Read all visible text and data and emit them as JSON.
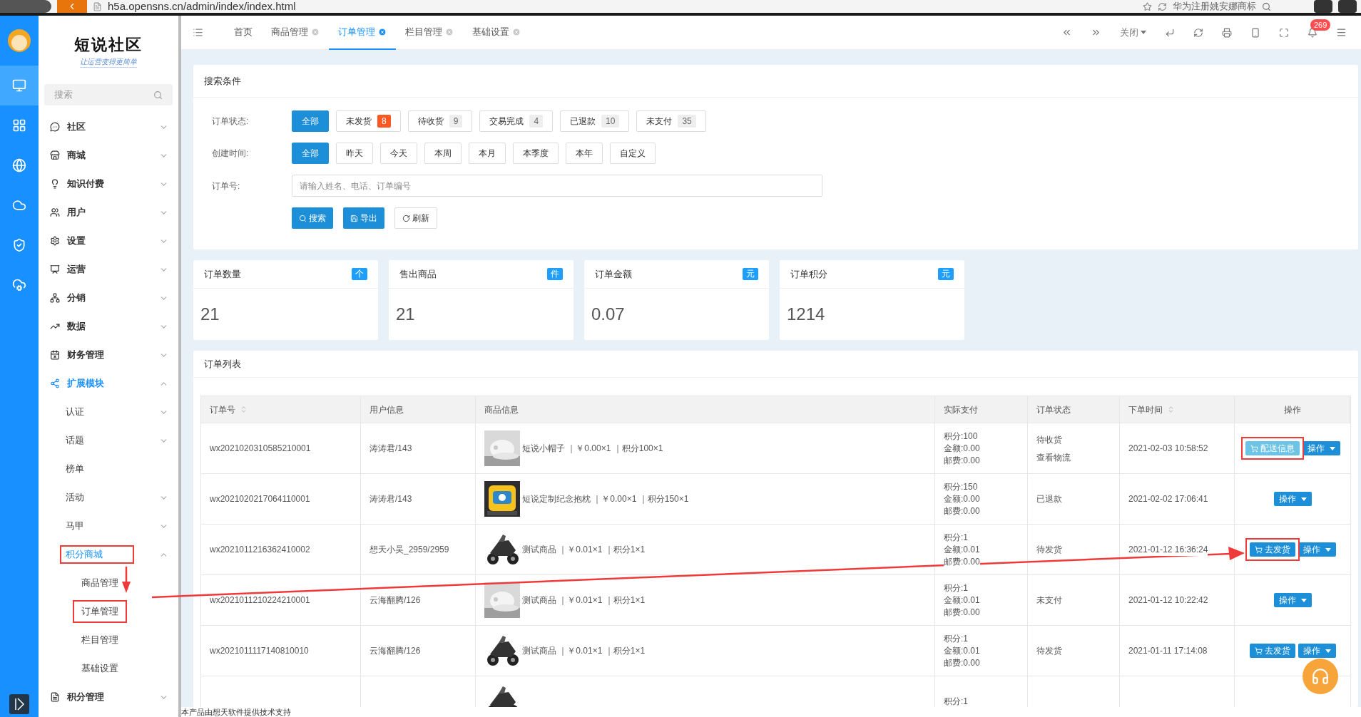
{
  "browser": {
    "url": "h5a.opensns.cn/admin/index/index.html",
    "search_text": "华为注册姚安娜商标"
  },
  "rail_items": [
    {
      "selected": true
    },
    {
      "selected": false
    },
    {
      "selected": false
    },
    {
      "selected": false
    },
    {
      "selected": false
    },
    {
      "selected": false
    }
  ],
  "sidebar": {
    "logo": "短说社区",
    "slogan": "让运营变得更简单",
    "search": {
      "placeholder": "搜索"
    },
    "items": [
      {
        "label": "社区",
        "expanded": false,
        "selected": false
      },
      {
        "label": "商城",
        "expanded": false,
        "selected": false
      },
      {
        "label": "知识付费",
        "expanded": false,
        "selected": false
      },
      {
        "label": "用户",
        "expanded": false,
        "selected": false
      },
      {
        "label": "设置",
        "expanded": false,
        "selected": false
      },
      {
        "label": "运营",
        "expanded": false,
        "selected": false
      },
      {
        "label": "分销",
        "expanded": false,
        "selected": false
      },
      {
        "label": "数据",
        "expanded": false,
        "selected": false
      },
      {
        "label": "财务管理",
        "expanded": false,
        "selected": false
      },
      {
        "label": "扩展模块",
        "expanded": true,
        "selected": true,
        "children": [
          {
            "label": "认证",
            "has_children": true,
            "expanded": false,
            "selected": false,
            "highlighted": false
          },
          {
            "label": "话题",
            "has_children": true,
            "expanded": false,
            "selected": false,
            "highlighted": false
          },
          {
            "label": "榜单",
            "has_children": false,
            "selected": false,
            "highlighted": false
          },
          {
            "label": "活动",
            "has_children": true,
            "expanded": false,
            "selected": false,
            "highlighted": false
          },
          {
            "label": "马甲",
            "has_children": true,
            "expanded": false,
            "selected": false,
            "highlighted": false
          },
          {
            "label": "积分商城",
            "has_children": true,
            "expanded": true,
            "selected": true,
            "highlighted": true,
            "children": [
              {
                "label": "商品管理",
                "highlighted": false
              },
              {
                "label": "订单管理",
                "highlighted": true
              },
              {
                "label": "栏目管理",
                "highlighted": false
              },
              {
                "label": "基础设置",
                "highlighted": false
              }
            ]
          }
        ]
      },
      {
        "label": "积分管理",
        "expanded": false,
        "selected": false
      }
    ]
  },
  "tabs": [
    {
      "label": "首页",
      "closable": false,
      "selected": false
    },
    {
      "label": "商品管理",
      "closable": true,
      "selected": false
    },
    {
      "label": "订单管理",
      "closable": true,
      "selected": true
    },
    {
      "label": "栏目管理",
      "closable": true,
      "selected": false
    },
    {
      "label": "基础设置",
      "closable": true,
      "selected": false
    }
  ],
  "toolbar": {
    "close_menu": "关闭",
    "notification_count": "269"
  },
  "search_panel": {
    "title": "搜索条件",
    "status_filter": {
      "label": "订单状态:",
      "options": [
        {
          "label": "全部",
          "selected": true
        },
        {
          "label": "未发货",
          "count": "8",
          "alert": true,
          "selected": false
        },
        {
          "label": "待收货",
          "count": "9",
          "alert": false,
          "selected": false
        },
        {
          "label": "交易完成",
          "count": "4",
          "alert": false,
          "selected": false
        },
        {
          "label": "已退款",
          "count": "10",
          "alert": false,
          "selected": false
        },
        {
          "label": "未支付",
          "count": "35",
          "alert": false,
          "selected": false
        }
      ]
    },
    "time_filter": {
      "label": "创建时间:",
      "options": [
        {
          "label": "全部",
          "selected": true
        },
        {
          "label": "昨天",
          "selected": false
        },
        {
          "label": "今天",
          "selected": false
        },
        {
          "label": "本周",
          "selected": false
        },
        {
          "label": "本月",
          "selected": false
        },
        {
          "label": "本季度",
          "selected": false
        },
        {
          "label": "本年",
          "selected": false
        },
        {
          "label": "自定义",
          "selected": false
        }
      ]
    },
    "order_field": {
      "label": "订单号:",
      "placeholder": "请输入姓名、电话、订单编号"
    },
    "buttons": [
      {
        "label": "搜索",
        "kind": "search"
      },
      {
        "label": "导出",
        "kind": "export"
      },
      {
        "label": "刷新",
        "kind": "refresh"
      }
    ]
  },
  "stats": [
    {
      "title": "订单数量",
      "unit": "个",
      "value": "21"
    },
    {
      "title": "售出商品",
      "unit": "件",
      "value": "21"
    },
    {
      "title": "订单金额",
      "unit": "元",
      "value": "0.07"
    },
    {
      "title": "订单积分",
      "unit": "元",
      "value": "1214"
    }
  ],
  "order_list": {
    "title": "订单列表",
    "columns": [
      {
        "label": "订单号",
        "sortable": true
      },
      {
        "label": "用户信息",
        "sortable": false
      },
      {
        "label": "商品信息",
        "sortable": false
      },
      {
        "label": "实际支付",
        "sortable": false
      },
      {
        "label": "订单状态",
        "sortable": false
      },
      {
        "label": "下单时间",
        "sortable": true
      },
      {
        "label": "操作",
        "sortable": false
      }
    ],
    "rows": [
      {
        "order_no": "wx2021020310585210001",
        "user": "涛涛君/143",
        "product": "短说小帽子 ｜￥0.00×1 ｜积分100×1",
        "pay": [
          "积分:100",
          "金额:0.00",
          "邮费:0.00"
        ],
        "status": [
          "待收货",
          "查看物流"
        ],
        "time": "2021-02-03 10:58:52",
        "actions": [
          {
            "label": "配送信息",
            "kind": "delivery",
            "highlighted": true
          },
          {
            "label": "操作",
            "kind": "menu",
            "highlighted": false
          }
        ]
      },
      {
        "order_no": "wx2021020217064110001",
        "user": "涛涛君/143",
        "product": "短说定制纪念抱枕 ｜￥0.00×1 ｜积分150×1",
        "pay": [
          "积分:150",
          "金额:0.00",
          "邮费:0.00"
        ],
        "status": [
          "已退款"
        ],
        "time": "2021-02-02 17:06:41",
        "actions": [
          {
            "label": "操作",
            "kind": "menu",
            "highlighted": false
          }
        ]
      },
      {
        "order_no": "wx2021011216362410002",
        "user": "想天小吴_2959/2959",
        "product": "测试商品 ｜￥0.01×1 ｜积分1×1",
        "pay": [
          "积分:1",
          "金额:0.01",
          "邮费:0.00"
        ],
        "status": [
          "待发货"
        ],
        "time": "2021-01-12 16:36:24",
        "actions": [
          {
            "label": "去发货",
            "kind": "ship",
            "highlighted": true
          },
          {
            "label": "操作",
            "kind": "menu",
            "highlighted": false
          }
        ]
      },
      {
        "order_no": "wx2021011210224210001",
        "user": "云海翻腾/126",
        "product": "测试商品 ｜￥0.01×1 ｜积分1×1",
        "pay": [
          "积分:1",
          "金额:0.01",
          "邮费:0.00"
        ],
        "status": [
          "未支付"
        ],
        "time": "2021-01-12 10:22:42",
        "actions": [
          {
            "label": "操作",
            "kind": "menu",
            "highlighted": false
          }
        ]
      },
      {
        "order_no": "wx2021011117140810010",
        "user": "云海翻腾/126",
        "product": "测试商品 ｜￥0.01×1 ｜积分1×1",
        "pay": [
          "积分:1",
          "金额:0.01",
          "邮费:0.00"
        ],
        "status": [
          "待发货"
        ],
        "time": "2021-01-11 17:14:08",
        "actions": [
          {
            "label": "去发货",
            "kind": "ship",
            "highlighted": false
          },
          {
            "label": "操作",
            "kind": "menu",
            "highlighted": false
          }
        ]
      },
      {
        "pay": [
          "积分:1"
        ]
      }
    ]
  },
  "footer": "本产品由想天软件提供技术支持"
}
